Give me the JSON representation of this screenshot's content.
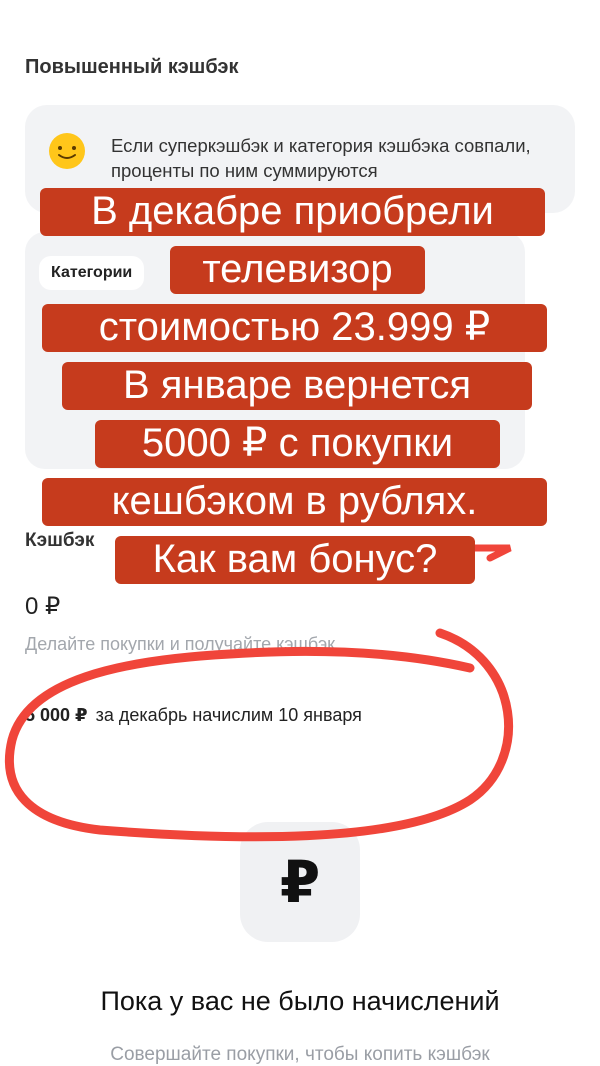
{
  "section": {
    "title": "Повышенный кэшбэк"
  },
  "info_card": {
    "icon": "smile-emoji-icon",
    "text": "Если суперкэшбэк и категория кэшбэка совпали, проценты по ним суммируются"
  },
  "categories": {
    "chip_label": "Категории"
  },
  "cashback": {
    "label": "Кэшбэк",
    "balance": "0 ₽",
    "hint": "Делайте покупки и получайте кэшбэк",
    "pending_amount": "5 000 ₽",
    "pending_text": "за декабрь начислим 10 января"
  },
  "empty_state": {
    "icon_glyph": "₽",
    "title": "Пока у вас не было начислений",
    "subtitle": "Совершайте покупки, чтобы копить кэшбэк"
  },
  "overlay": {
    "lines": [
      "В декабре приобрели",
      "телевизор",
      "стоимостью 23.999 ₽",
      "В январе вернется",
      "5000 ₽ с покупки",
      "кешбэком в рублях.",
      "Как вам бонус?"
    ],
    "bg_color": "#c63b1d",
    "circle_color": "#f0453a"
  }
}
